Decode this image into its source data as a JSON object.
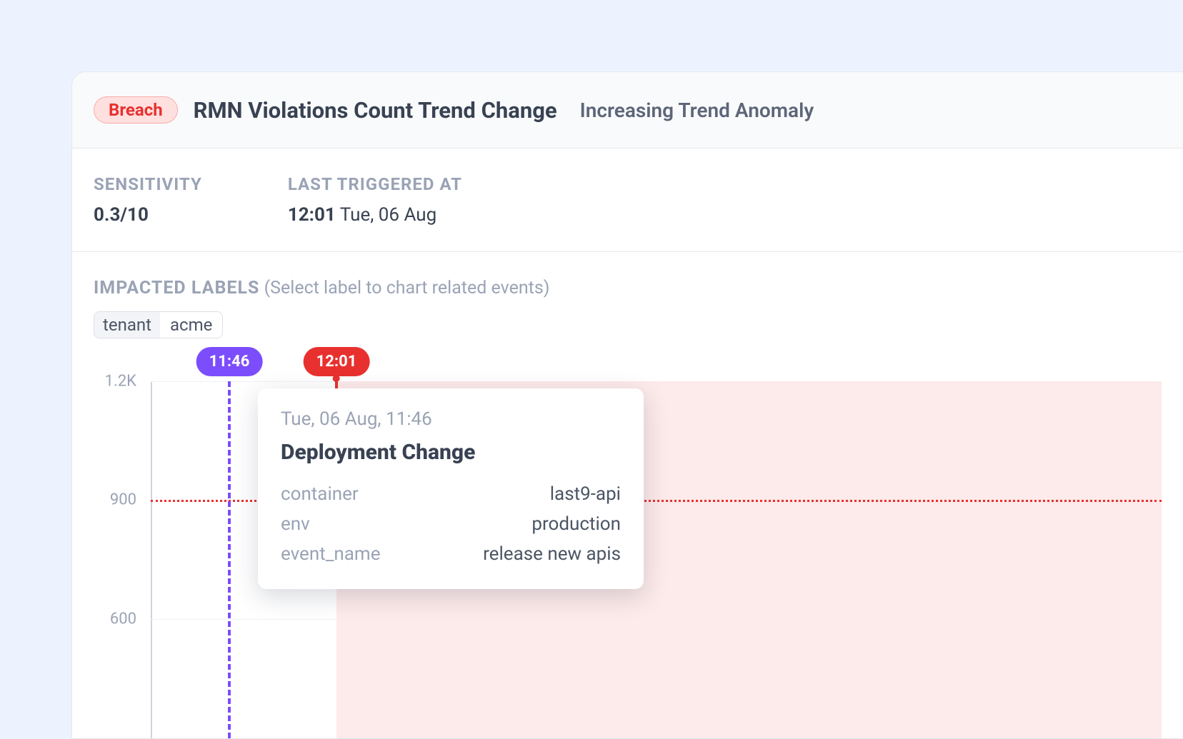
{
  "header": {
    "badge": "Breach",
    "title": "RMN Violations Count Trend Change",
    "subtitle": "Increasing Trend Anomaly"
  },
  "summary": {
    "sensitivity": {
      "label": "SENSITIVITY",
      "value": "0.3/10"
    },
    "last_triggered": {
      "label": "LAST TRIGGERED AT",
      "time": "12:01",
      "date": "Tue, 06 Aug"
    }
  },
  "impacted_labels": {
    "header_strong": "IMPACTED LABELS",
    "header_hint": "(Select label to chart related events)",
    "chip": {
      "key": "tenant",
      "value": "acme"
    }
  },
  "chart_data": {
    "type": "line",
    "title": "",
    "xlabel": "",
    "ylabel": "",
    "ylim": [
      300,
      1200
    ],
    "yticks": [
      600,
      900,
      "1.2K"
    ],
    "threshold": 900,
    "anomaly_zone_start": "12:01",
    "events": [
      {
        "time": "11:46",
        "kind": "deploy",
        "color": "purple"
      },
      {
        "time": "12:01",
        "kind": "breach",
        "color": "red"
      }
    ]
  },
  "tooltip": {
    "timestamp": "Tue, 06 Aug, 11:46",
    "title": "Deployment Change",
    "rows": [
      {
        "k": "container",
        "v": "last9-api"
      },
      {
        "k": "env",
        "v": "production"
      },
      {
        "k": "event_name",
        "v": "release new apis"
      }
    ]
  }
}
